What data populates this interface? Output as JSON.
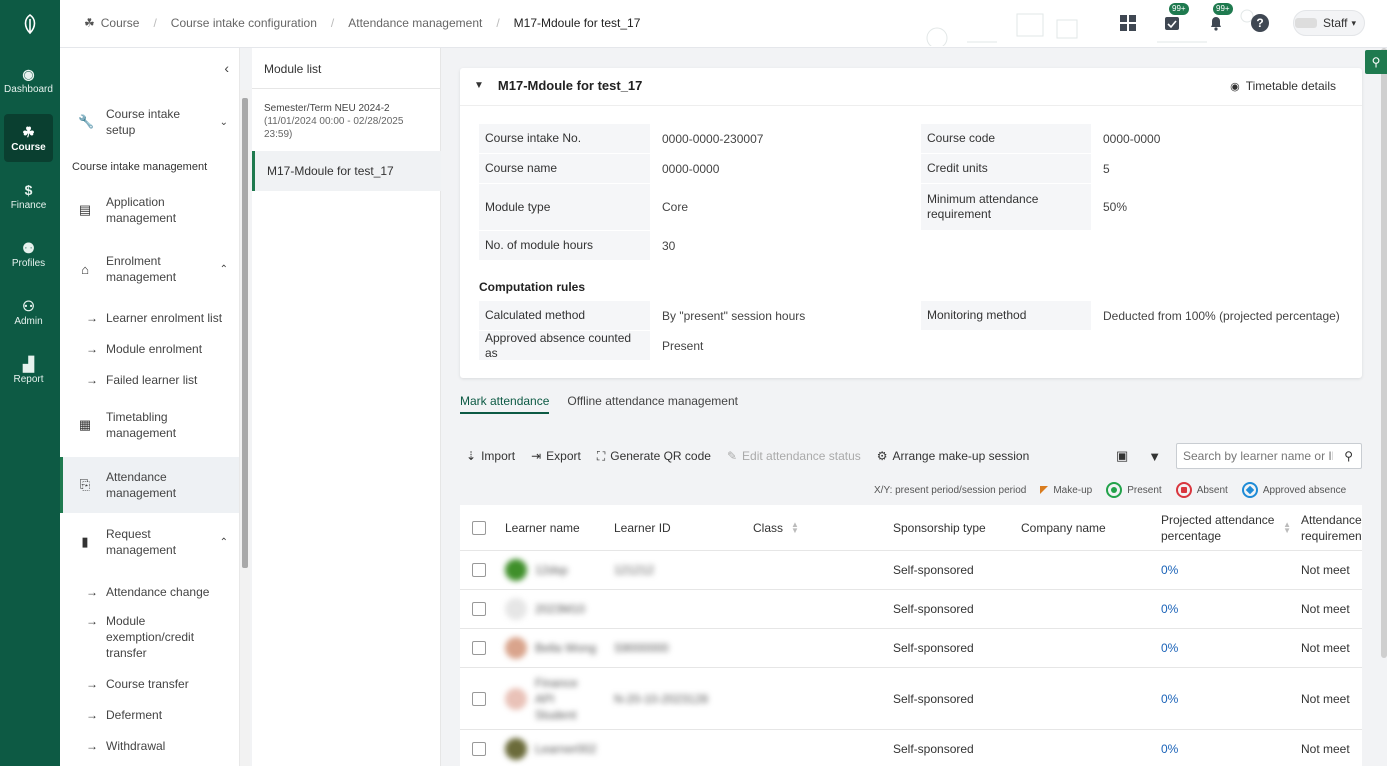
{
  "nav_rail": [
    {
      "label": "Dashboard",
      "icon": "gauge-icon"
    },
    {
      "label": "Course",
      "icon": "course-icon",
      "active": true
    },
    {
      "label": "Finance",
      "icon": "dollar-icon"
    },
    {
      "label": "Profiles",
      "icon": "people-icon"
    },
    {
      "label": "Admin",
      "icon": "admin-icon"
    },
    {
      "label": "Report",
      "icon": "chart-icon"
    }
  ],
  "breadcrumb": [
    "Course",
    "Course intake configuration",
    "Attendance management",
    "M17-Mdoule for test_17"
  ],
  "header": {
    "task_badge": "99+",
    "notify_badge": "99+",
    "user": "Staff"
  },
  "sidenav": {
    "groups": [
      {
        "label": "Course intake setup",
        "icon": "wrench-icon"
      },
      {
        "label": "Application management",
        "icon": "list-icon"
      },
      {
        "label": "Enrolment management",
        "icon": "building-icon"
      },
      {
        "label": "Timetabling management",
        "icon": "grid-icon"
      },
      {
        "label": "Attendance management",
        "icon": "attendance-icon"
      },
      {
        "label": "Request management",
        "icon": "clipboard-icon"
      }
    ],
    "section": "Course intake management",
    "enrolment_items": [
      "Learner enrolment list",
      "Module enrolment",
      "Failed learner list"
    ],
    "request_items": [
      "Attendance change",
      "Module exemption/credit transfer",
      "Course transfer",
      "Deferment",
      "Withdrawal"
    ]
  },
  "module_list": {
    "title": "Module list",
    "semester": "Semester/Term NEU 2024-2",
    "semester_dates": "(11/01/2024 00:00 - 02/28/2025 23:59)",
    "selected": "M17-Mdoule for test_17"
  },
  "details": {
    "title": "M17-Mdoule for test_17",
    "timetable_link": "Timetable details",
    "fields": [
      {
        "k": "Course intake No.",
        "v": "0000-0000-230007"
      },
      {
        "k": "Course code",
        "v": "0000-0000"
      },
      {
        "k": "Course name",
        "v": "0000-0000"
      },
      {
        "k": "Credit units",
        "v": "5"
      },
      {
        "k": "Module type",
        "v": "Core"
      },
      {
        "k": "Minimum attendance requirement",
        "v": "50%"
      },
      {
        "k": "No. of module hours",
        "v": "30"
      }
    ],
    "computation_title": "Computation rules",
    "rules": [
      {
        "k": "Calculated method",
        "v": "By \"present\" session hours"
      },
      {
        "k": "Monitoring method",
        "v": "Deducted from 100% (projected percentage)"
      },
      {
        "k": "Approved absence counted as",
        "v": "Present"
      }
    ]
  },
  "tabs": [
    "Mark attendance",
    "Offline attendance management"
  ],
  "toolbar": {
    "import": "Import",
    "export": "Export",
    "qr": "Generate QR code",
    "edit": "Edit attendance status",
    "makeup": "Arrange make-up session",
    "search_placeholder": "Search by learner name or ID"
  },
  "legend": {
    "xy": "X/Y: present period/session period",
    "makeup": "Make-up",
    "present": "Present",
    "absent": "Absent",
    "approved": "Approved absence"
  },
  "colors": {
    "present": "#22a24a",
    "absent": "#d9363e",
    "approved": "#1f8bd6",
    "makeup": "#d97c1e",
    "brand": "#0d5a44"
  },
  "table": {
    "headers": {
      "name": "Learner name",
      "id": "Learner ID",
      "class": "Class",
      "sponsorship": "Sponsorship type",
      "company": "Company name",
      "projected": "Projected attendance percentage",
      "requirement": "Attendance requirement"
    },
    "rows": [
      {
        "name": "12dsp",
        "id": "121212",
        "sponsorship": "Self-sponsored",
        "pct": "0%",
        "req": "Not meet"
      },
      {
        "name": "2023M10",
        "id": "",
        "sponsorship": "Self-sponsored",
        "pct": "0%",
        "req": "Not meet"
      },
      {
        "name": "Bella Wong",
        "id": "S9000000",
        "sponsorship": "Self-sponsored",
        "pct": "0%",
        "req": "Not meet"
      },
      {
        "name": "Finance API Student",
        "id": "N-20-10-2023128",
        "sponsorship": "Self-sponsored",
        "pct": "0%",
        "req": "Not meet"
      },
      {
        "name": "Learner002",
        "id": "",
        "sponsorship": "Self-sponsored",
        "pct": "0%",
        "req": "Not meet"
      }
    ]
  }
}
